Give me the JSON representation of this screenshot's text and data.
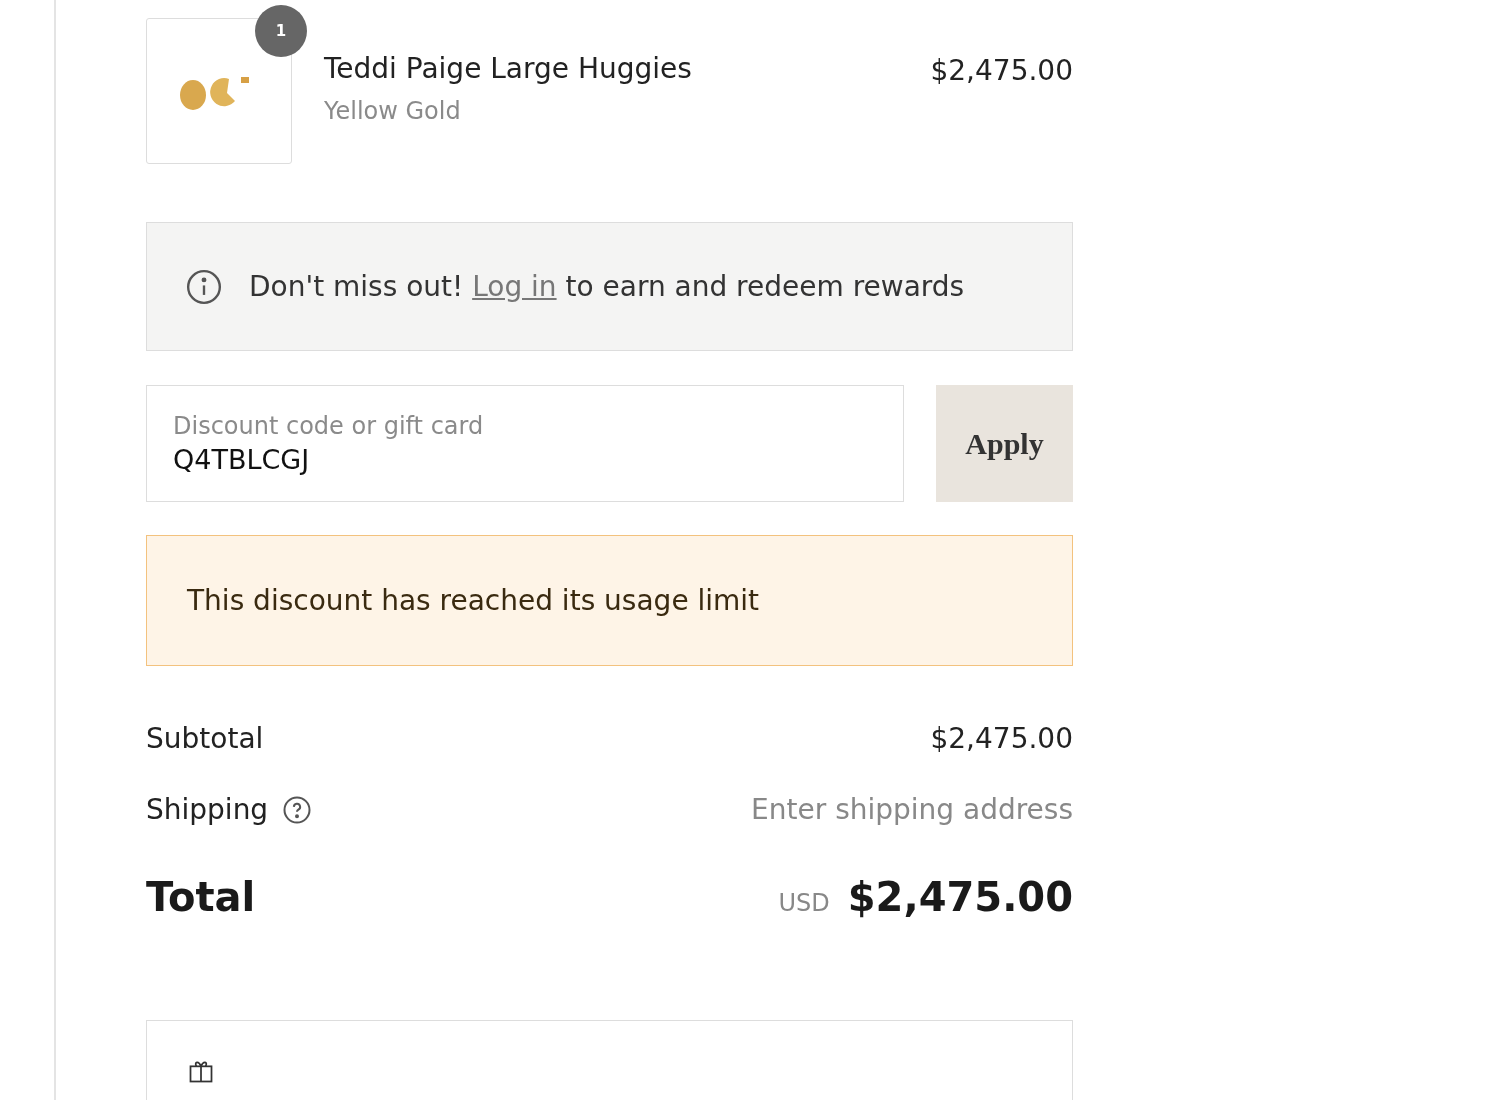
{
  "line_item": {
    "quantity": "1",
    "name": "Teddi Paige Large Huggies",
    "variant": "Yellow Gold",
    "price": "$2,475.00"
  },
  "rewards_notice": {
    "text_before": "Don't miss out!",
    "link": "Log in",
    "text_after": "to earn and redeem rewards"
  },
  "discount": {
    "label": "Discount code or gift card",
    "value": "Q4TBLCGJ",
    "button": "Apply"
  },
  "error": {
    "message": "This discount has reached its usage limit"
  },
  "summary": {
    "subtotal_label": "Subtotal",
    "subtotal_value": "$2,475.00",
    "shipping_label": "Shipping",
    "shipping_value": "Enter shipping address",
    "total_label": "Total",
    "currency": "USD",
    "total_value": "$2,475.00"
  }
}
